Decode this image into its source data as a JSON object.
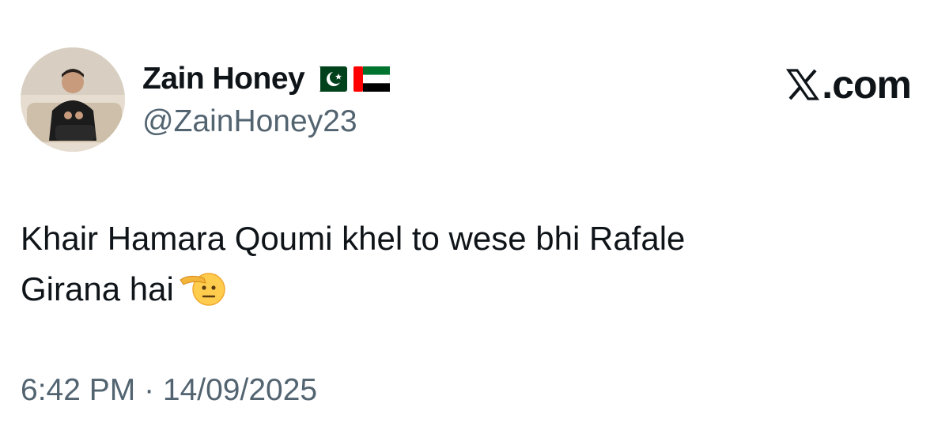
{
  "author": {
    "display_name": "Zain Honey",
    "handle": "@ZainHoney23",
    "flags": [
      "pakistan-flag-icon",
      "uae-flag-icon"
    ],
    "avatar": "profile-photo"
  },
  "brand": {
    "label": ".com",
    "icon": "x-logo-icon"
  },
  "tweet": {
    "line1": "Khair Hamara Qoumi khel to wese bhi Rafale",
    "line2": "Girana hai",
    "emoji": "saluting-face-emoji"
  },
  "timestamp": "6:42 PM · 14/09/2025",
  "colors": {
    "text_primary": "#0f1419",
    "text_secondary": "#536471",
    "background": "#ffffff"
  }
}
